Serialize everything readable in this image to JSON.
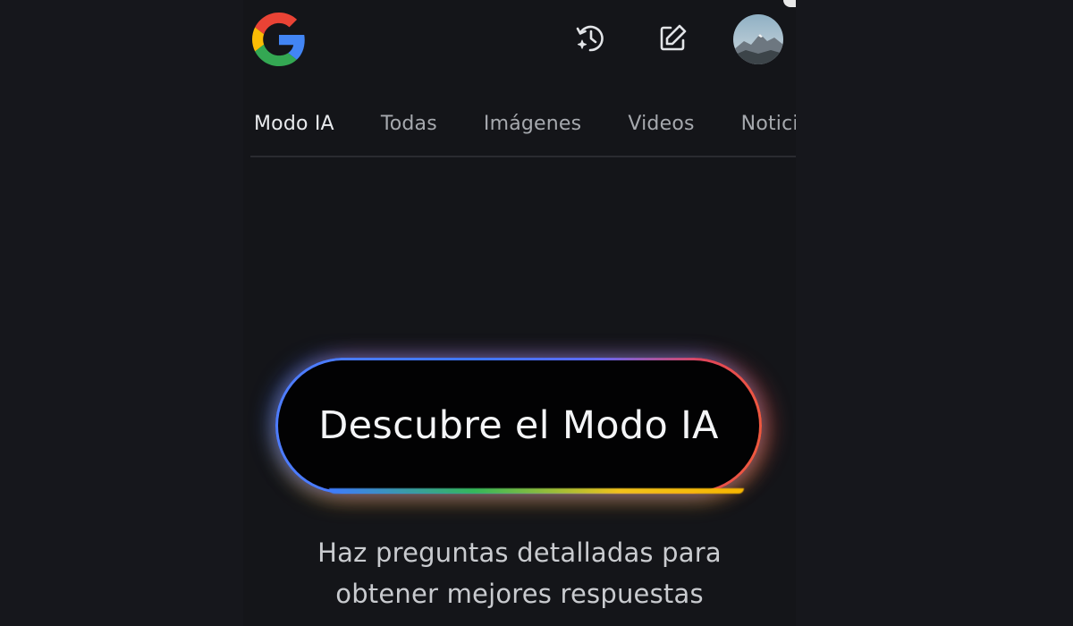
{
  "header": {
    "logo": "google-g-logo",
    "icons": [
      "history-ai-icon",
      "edit-icon"
    ],
    "avatar": "profile-avatar"
  },
  "tabs": [
    {
      "label": "Modo IA",
      "active": true
    },
    {
      "label": "Todas",
      "active": false
    },
    {
      "label": "Imágenes",
      "active": false
    },
    {
      "label": "Videos",
      "active": false
    },
    {
      "label": "Noticias",
      "active": false
    }
  ],
  "cta": {
    "label": "Descubre el Modo IA"
  },
  "subtitle": {
    "line1": "Haz preguntas detalladas para",
    "line2": "obtener mejores respuestas"
  },
  "colors": {
    "background": "#141519",
    "google_blue": "#4285F4",
    "google_red": "#EA4335",
    "google_yellow": "#FBBC05",
    "google_green": "#34A853"
  }
}
